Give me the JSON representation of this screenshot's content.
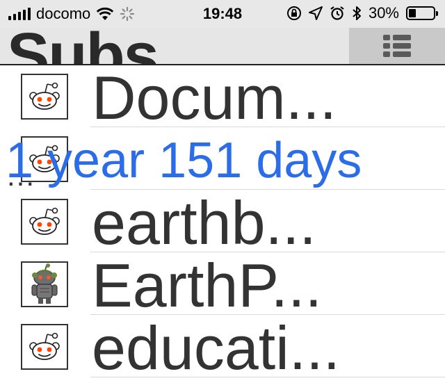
{
  "status_bar": {
    "carrier": "docomo",
    "time": "19:48",
    "battery_percent": "30%",
    "battery_level": 0.3,
    "icons": [
      "signal-icon",
      "wifi-icon",
      "activity-spinner-icon",
      "orientation-lock-icon",
      "location-icon",
      "alarm-icon",
      "bluetooth-icon",
      "battery-icon"
    ]
  },
  "nav": {
    "title": "Subs",
    "right_icon": "list-view-icon"
  },
  "subs": [
    {
      "label": "Docum...",
      "icon": "reddit-alien-icon"
    },
    {
      "label": "",
      "icon": "reddit-alien-icon"
    },
    {
      "label": "earthb...",
      "icon": "reddit-alien-icon"
    },
    {
      "label": "EarthP...",
      "icon": "robot-avatar-icon"
    },
    {
      "label": "educati...",
      "icon": "reddit-alien-icon"
    }
  ],
  "overlay": {
    "elapsed": "1 year 151 days",
    "truncated": "..."
  },
  "colors": {
    "accent": "#2b6de8",
    "text": "#333333",
    "nav_bg": "#e6e6e6",
    "alien_eyes": "#ff4500"
  }
}
